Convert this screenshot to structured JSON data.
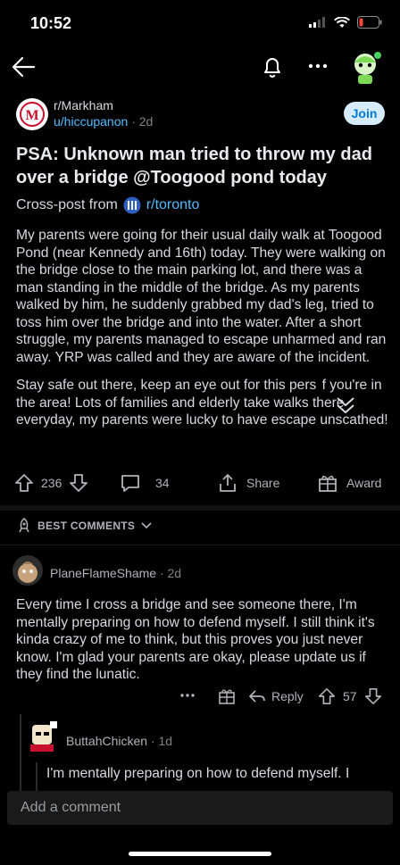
{
  "status_bar": {
    "time": "10:52"
  },
  "post": {
    "subreddit": "r/Markham",
    "author": "u/hiccupanon",
    "age": "2d",
    "join_label": "Join",
    "title": "PSA: Unknown man tried to throw my dad over a bridge @Toogood pond today",
    "crosspost_prefix": "Cross-post from",
    "crosspost_sub": "r/toronto",
    "body_p1": "My parents were going for their usual daily walk at Toogood Pond (near Kennedy and 16th) today. They were walking on the bridge close to the main parking lot, and there was a man standing in the middle of the bridge. As my parents walked by him, he suddenly grabbed my dad's leg, tried to toss him over the bridge and into the water. After a short struggle, my parents managed to escape unharmed and ran away. YRP was called and they are aware of the incident.",
    "body_p2": "Stay safe out there, keep an eye out for this pers  f you're in the area! Lots of families and elderly take walks there everyday, my parents were lucky to have escape unscathed!",
    "votes": "236",
    "comments": "34",
    "share_label": "Share",
    "award_label": "Award"
  },
  "sort": {
    "label": "BEST COMMENTS"
  },
  "comment": {
    "author": "PlaneFlameShame",
    "age": "2d",
    "body": "Every time I cross a bridge and see someone there, I'm mentally preparing on how to defend myself. I still think it's kinda crazy of me to think, but this proves you just never know. I'm glad your parents are okay, please update us if they find the lunatic.",
    "reply_label": "Reply",
    "votes": "57"
  },
  "reply": {
    "author": "ButtahChicken",
    "age": "1d",
    "body_preview": "I'm mentally preparing on how to defend myself. I"
  },
  "composer": {
    "placeholder": "Add a comment"
  },
  "colors": {
    "accent": "#4fbcff",
    "join_bg": "#d7ecfb",
    "battery": "#ff453a"
  }
}
